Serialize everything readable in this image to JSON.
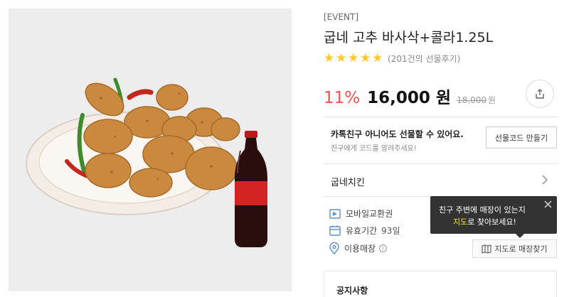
{
  "product": {
    "event_tag": "[EVENT]",
    "title": "굽네 고추 바사삭+콜라1.25L",
    "rating_stars": 5,
    "review_text": "(201건의 선물후기)",
    "discount": "11%",
    "price": "16,000 원",
    "original_price": "18,000",
    "original_unit": "원"
  },
  "gift": {
    "title": "카톡친구 아니어도 선물할 수 있어요.",
    "subtitle": "친구에게 코드를 알려주세요!",
    "button_label": "선물코드 만들기"
  },
  "brand": {
    "name": "굽네치킨"
  },
  "details": [
    {
      "label": "모바일교환권",
      "value": "",
      "icon": "ticket-icon"
    },
    {
      "label": "유효기간",
      "value": "93일",
      "icon": "calendar-icon"
    },
    {
      "label": "이용매장",
      "value": "",
      "icon": "location-pin-icon"
    }
  ],
  "tooltip": {
    "line1": "친구 주변에 매장이 있는지",
    "line2_highlight": "지도",
    "line2_rest": "로 찾아보세요!"
  },
  "map_button": {
    "label": "지도로 매장찾기",
    "icon": "map-icon"
  },
  "notice": {
    "title": "공지사항"
  },
  "colors": {
    "accent_red": "#f24f4f",
    "star": "#ffc72c",
    "tooltip_bg": "#333333",
    "highlight": "#ffe812",
    "icon_blue": "#5b8ec9"
  }
}
